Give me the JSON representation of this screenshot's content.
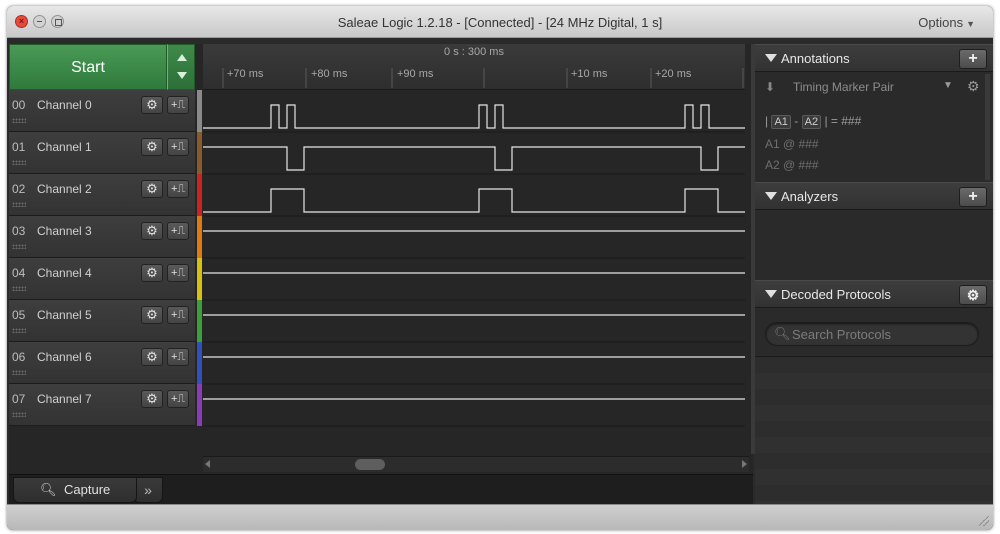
{
  "window": {
    "title": "Saleae Logic 1.2.18 - [Connected] - [24 MHz Digital, 1 s]",
    "options_label": "Options"
  },
  "capture": {
    "start_label": "Start"
  },
  "channels": [
    {
      "num": "00",
      "name": "Channel 0",
      "color": "#8a8a8a"
    },
    {
      "num": "01",
      "name": "Channel 1",
      "color": "#8b5a2b"
    },
    {
      "num": "02",
      "name": "Channel 2",
      "color": "#cc2222"
    },
    {
      "num": "03",
      "name": "Channel 3",
      "color": "#e07a10"
    },
    {
      "num": "04",
      "name": "Channel 4",
      "color": "#d8c010"
    },
    {
      "num": "05",
      "name": "Channel 5",
      "color": "#3aa03a"
    },
    {
      "num": "06",
      "name": "Channel 6",
      "color": "#3050c0"
    },
    {
      "num": "07",
      "name": "Channel 7",
      "color": "#8a3aba"
    }
  ],
  "timeline": {
    "main_label": "0 s : 300 ms",
    "ticks": [
      "+70 ms",
      "+80 ms",
      "+90 ms",
      "+10 ms",
      "+20 ms"
    ]
  },
  "tabs": {
    "capture_label": "Capture",
    "more_label": "»"
  },
  "annotations": {
    "header": "Annotations",
    "marker_pair": "Timing Marker Pair",
    "a1": "A1",
    "a2": "A2",
    "dash": "-",
    "eq": "= ###",
    "row_a1_label": "A1",
    "row_a1_value": "@ ###",
    "row_a2_label": "A2",
    "row_a2_value": "@ ###"
  },
  "analyzers": {
    "header": "Analyzers"
  },
  "decoded_protocols": {
    "header": "Decoded Protocols",
    "search_placeholder": "Search Protocols"
  }
}
